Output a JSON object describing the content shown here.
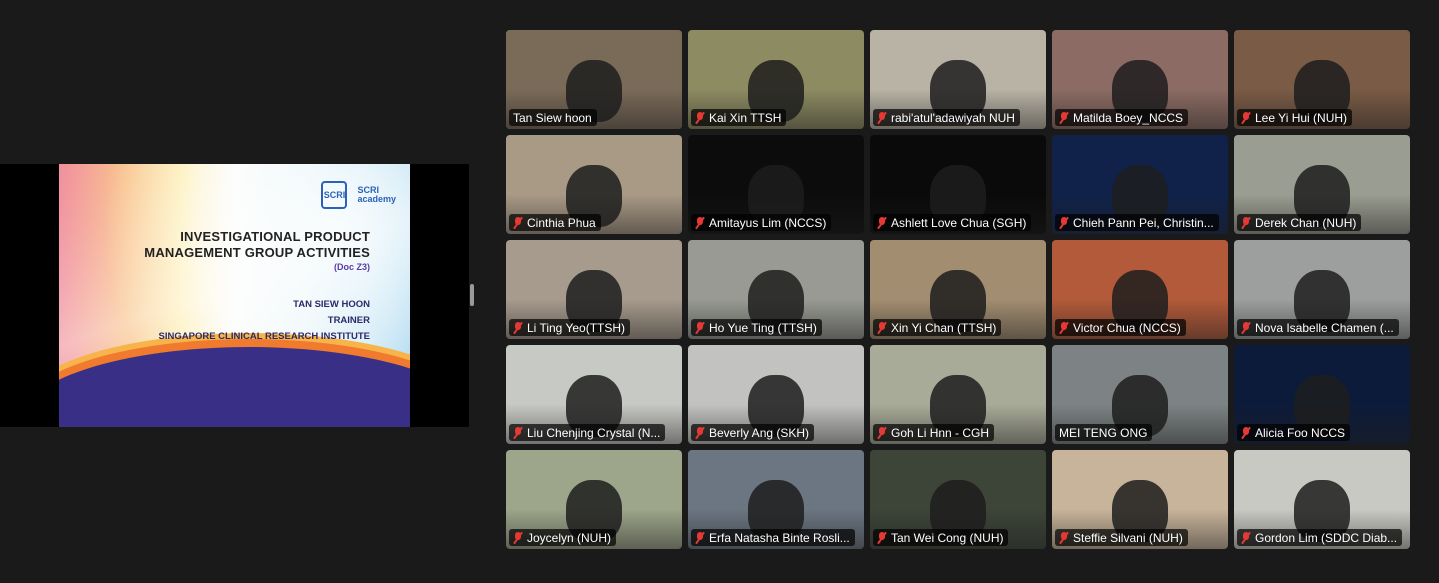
{
  "slide": {
    "logo_left": "SCRI",
    "logo_right_top": "SCRI",
    "logo_right_bottom": "academy",
    "title_line1": "INVESTIGATIONAL PRODUCT",
    "title_line2": "MANAGEMENT GROUP ACTIVITIES",
    "doc": "(Doc Z3)",
    "presenter": "TAN SIEW HOON",
    "role": "TRAINER",
    "organization": "SINGAPORE CLINICAL RESEARCH INSTITUTE"
  },
  "participants": [
    {
      "name": "Tan Siew hoon",
      "muted": false,
      "active": true,
      "bg": "#7a6a58"
    },
    {
      "name": "Kai Xin TTSH",
      "muted": true,
      "bg": "#8d8b62"
    },
    {
      "name": "rabi'atul'adawiyah NUH",
      "muted": true,
      "bg": "#b9b3a5"
    },
    {
      "name": "Matilda Boey_NCCS",
      "muted": true,
      "bg": "#8b6b63"
    },
    {
      "name": "Lee Yi Hui (NUH)",
      "muted": true,
      "bg": "#7a5b45"
    },
    {
      "name": "Cinthia Phua",
      "muted": true,
      "bg": "#a99a86"
    },
    {
      "name": "Amitayus Lim (NCCS)",
      "muted": true,
      "bg": "#0c0c0c"
    },
    {
      "name": "Ashlett Love Chua (SGH)",
      "muted": true,
      "bg": "#0a0a0a"
    },
    {
      "name": "Chieh Pann Pei, Christin...",
      "muted": true,
      "bg": "#10224a"
    },
    {
      "name": "Derek Chan (NUH)",
      "muted": true,
      "bg": "#9a9d91"
    },
    {
      "name": "Li Ting Yeo(TTSH)",
      "muted": true,
      "bg": "#a79b8d"
    },
    {
      "name": "Ho Yue Ting (TTSH)",
      "muted": true,
      "bg": "#989a93"
    },
    {
      "name": "Xin Yi Chan (TTSH)",
      "muted": true,
      "bg": "#a28d70"
    },
    {
      "name": "Victor Chua (NCCS)",
      "muted": true,
      "bg": "#b25a3a"
    },
    {
      "name": "Nova Isabelle Chamen (...",
      "muted": true,
      "bg": "#9c9f9d"
    },
    {
      "name": "Liu Chenjing Crystal (N...",
      "muted": true,
      "bg": "#c7c9c4"
    },
    {
      "name": "Beverly Ang (SKH)",
      "muted": true,
      "bg": "#c2c2c0"
    },
    {
      "name": "Goh Li Hnn - CGH",
      "muted": true,
      "bg": "#a9ab99"
    },
    {
      "name": "MEI TENG ONG",
      "muted": false,
      "bg": "#7d8384"
    },
    {
      "name": "Alicia Foo NCCS",
      "muted": true,
      "bg": "#0d1b3a"
    },
    {
      "name": "Joycelyn (NUH)",
      "muted": true,
      "bg": "#9da58a"
    },
    {
      "name": "Erfa Natasha Binte Rosli...",
      "muted": true,
      "bg": "#6b7682"
    },
    {
      "name": "Tan Wei Cong (NUH)",
      "muted": true,
      "bg": "#3d4438"
    },
    {
      "name": "Steffie Silvani (NUH)",
      "muted": true,
      "bg": "#c8b49a"
    },
    {
      "name": "Gordon Lim (SDDC Diab...",
      "muted": true,
      "bg": "#c9c9c4"
    }
  ]
}
